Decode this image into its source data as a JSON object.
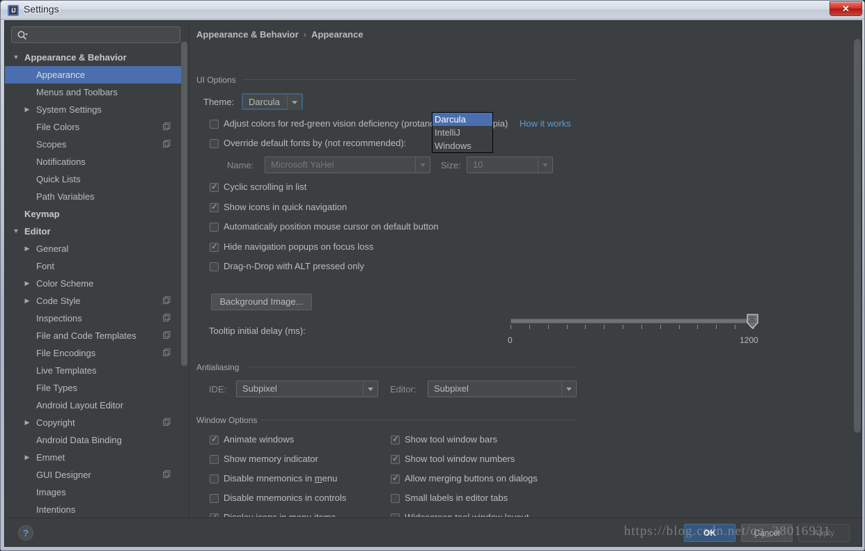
{
  "window": {
    "title": "Settings",
    "app_icon": "IJ",
    "close_label": "✕"
  },
  "search": {
    "placeholder": "",
    "value": "",
    "icon": "search-icon"
  },
  "sidebar": {
    "items": [
      {
        "label": "Appearance & Behavior",
        "level": 0,
        "arrow": "▼",
        "bold": true,
        "selected": false,
        "copy": false
      },
      {
        "label": "Appearance",
        "level": 1,
        "arrow": "",
        "bold": false,
        "selected": true,
        "copy": false
      },
      {
        "label": "Menus and Toolbars",
        "level": 1,
        "arrow": "",
        "bold": false,
        "selected": false,
        "copy": false
      },
      {
        "label": "System Settings",
        "level": 1,
        "arrow": "▶",
        "bold": false,
        "selected": false,
        "copy": false
      },
      {
        "label": "File Colors",
        "level": 1,
        "arrow": "",
        "bold": false,
        "selected": false,
        "copy": true
      },
      {
        "label": "Scopes",
        "level": 1,
        "arrow": "",
        "bold": false,
        "selected": false,
        "copy": true
      },
      {
        "label": "Notifications",
        "level": 1,
        "arrow": "",
        "bold": false,
        "selected": false,
        "copy": false
      },
      {
        "label": "Quick Lists",
        "level": 1,
        "arrow": "",
        "bold": false,
        "selected": false,
        "copy": false
      },
      {
        "label": "Path Variables",
        "level": 1,
        "arrow": "",
        "bold": false,
        "selected": false,
        "copy": false
      },
      {
        "label": "Keymap",
        "level": 0,
        "arrow": "",
        "bold": true,
        "selected": false,
        "copy": false
      },
      {
        "label": "Editor",
        "level": 0,
        "arrow": "▼",
        "bold": true,
        "selected": false,
        "copy": false
      },
      {
        "label": "General",
        "level": 1,
        "arrow": "▶",
        "bold": false,
        "selected": false,
        "copy": false
      },
      {
        "label": "Font",
        "level": 1,
        "arrow": "",
        "bold": false,
        "selected": false,
        "copy": false
      },
      {
        "label": "Color Scheme",
        "level": 1,
        "arrow": "▶",
        "bold": false,
        "selected": false,
        "copy": false
      },
      {
        "label": "Code Style",
        "level": 1,
        "arrow": "▶",
        "bold": false,
        "selected": false,
        "copy": true
      },
      {
        "label": "Inspections",
        "level": 1,
        "arrow": "",
        "bold": false,
        "selected": false,
        "copy": true
      },
      {
        "label": "File and Code Templates",
        "level": 1,
        "arrow": "",
        "bold": false,
        "selected": false,
        "copy": true
      },
      {
        "label": "File Encodings",
        "level": 1,
        "arrow": "",
        "bold": false,
        "selected": false,
        "copy": true
      },
      {
        "label": "Live Templates",
        "level": 1,
        "arrow": "",
        "bold": false,
        "selected": false,
        "copy": false
      },
      {
        "label": "File Types",
        "level": 1,
        "arrow": "",
        "bold": false,
        "selected": false,
        "copy": false
      },
      {
        "label": "Android Layout Editor",
        "level": 1,
        "arrow": "",
        "bold": false,
        "selected": false,
        "copy": false
      },
      {
        "label": "Copyright",
        "level": 1,
        "arrow": "▶",
        "bold": false,
        "selected": false,
        "copy": true
      },
      {
        "label": "Android Data Binding",
        "level": 1,
        "arrow": "",
        "bold": false,
        "selected": false,
        "copy": false
      },
      {
        "label": "Emmet",
        "level": 1,
        "arrow": "▶",
        "bold": false,
        "selected": false,
        "copy": false
      },
      {
        "label": "GUI Designer",
        "level": 1,
        "arrow": "",
        "bold": false,
        "selected": false,
        "copy": true
      },
      {
        "label": "Images",
        "level": 1,
        "arrow": "",
        "bold": false,
        "selected": false,
        "copy": false
      },
      {
        "label": "Intentions",
        "level": 1,
        "arrow": "",
        "bold": false,
        "selected": false,
        "copy": false
      }
    ]
  },
  "breadcrumb": {
    "parent": "Appearance & Behavior",
    "separator": "›",
    "current": "Appearance"
  },
  "ui_options": {
    "section_title": "UI Options",
    "theme_label": "Theme:",
    "theme_value": "Darcula",
    "theme_options": [
      "Darcula",
      "IntelliJ",
      "Windows"
    ],
    "theme_selected_index": 0,
    "adjust_colors_label": "Adjust colors for red-green vision deficiency (protanopia, deuteranopia)",
    "adjust_colors_checked": false,
    "how_it_works_link": "How it works",
    "override_fonts_label": "Override default fonts by (not recommended):",
    "override_fonts_checked": false,
    "name_label": "Name:",
    "name_value": "Microsoft YaHei",
    "size_label": "Size:",
    "size_value": "10",
    "checkboxes": [
      {
        "label": "Cyclic scrolling in list",
        "checked": true
      },
      {
        "label": "Show icons in quick navigation",
        "checked": true
      },
      {
        "label": "Automatically position mouse cursor on default button",
        "checked": false
      },
      {
        "label": "Hide navigation popups on focus loss",
        "checked": true
      },
      {
        "label": "Drag-n-Drop with ALT pressed only",
        "checked": false
      }
    ],
    "background_image_button": "Background Image...",
    "tooltip_delay_label": "Tooltip initial delay (ms):",
    "tooltip_delay_min": "0",
    "tooltip_delay_max": "1200",
    "tooltip_delay_value": 1200
  },
  "antialiasing": {
    "section_title": "Antialiasing",
    "ide_label": "IDE:",
    "ide_value": "Subpixel",
    "editor_label": "Editor:",
    "editor_value": "Subpixel"
  },
  "window_options": {
    "section_title": "Window Options",
    "left_column": [
      {
        "label": "Animate windows",
        "checked": true
      },
      {
        "label": "Show memory indicator",
        "checked": false
      },
      {
        "label": "Disable mnemonics in menu",
        "checked": false,
        "mnemonic": "m"
      },
      {
        "label": "Disable mnemonics in controls",
        "checked": false
      },
      {
        "label": "Display icons in menu items",
        "checked": true
      }
    ],
    "right_column": [
      {
        "label": "Show tool window bars",
        "checked": true
      },
      {
        "label": "Show tool window numbers",
        "checked": true
      },
      {
        "label": "Allow merging buttons on dialogs",
        "checked": true
      },
      {
        "label": "Small labels in editor tabs",
        "checked": false
      },
      {
        "label": "Widescreen tool window layout",
        "checked": false
      }
    ]
  },
  "footer": {
    "help_icon": "?",
    "ok_label": "OK",
    "cancel_label": "Cancel",
    "apply_label": "Apply"
  },
  "watermark": {
    "text": "https://blog.csdn.net/qq_38016931"
  },
  "colors": {
    "background": "#3c3f41",
    "selection": "#4b6eaf",
    "accent_button": "#365880",
    "link": "#5a9bd5",
    "text": "#bbbbbb"
  }
}
